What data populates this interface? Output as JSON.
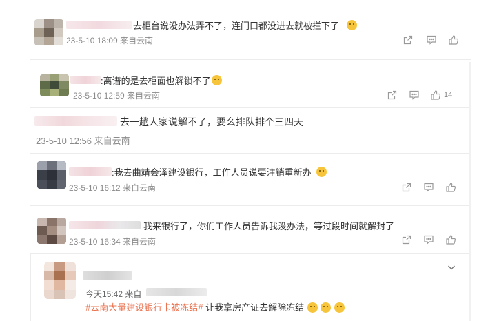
{
  "comments": [
    {
      "text": "去柜台说没办法弄不了，连门口都没进去就被拦下了",
      "time": "23-5-10 18:09 来自云南"
    },
    {
      "text": ":离谱的是去柜面也解锁不了",
      "time": "23-5-10 12:59 来自云南",
      "likes": "14"
    },
    {
      "text": "去一趟人家说解不了，要么排队排个三四天",
      "time": "23-5-10 12:56 来自云南"
    },
    {
      "text": ":我去曲靖会泽建设银行，工作人员说要注销重新办",
      "time": "23-5-10 16:12 来自云南"
    },
    {
      "text": "我来银行了，你们工作人员告诉我没办法，等过段时间就解封了",
      "time": "23-5-10 16:34 来自云南"
    }
  ],
  "last": {
    "time_prefix": "今天15:42 来自",
    "hashtag": "#云南大量建设银行卡被冻结#",
    "text": " 让我拿房产证去解除冻结"
  },
  "icons": {
    "share": "share-icon",
    "comment": "comment-icon",
    "like": "like-icon",
    "expand": "chevron-down-icon"
  },
  "colors": {
    "hashtag": "#eb7350",
    "meta": "#8a8a8a"
  }
}
